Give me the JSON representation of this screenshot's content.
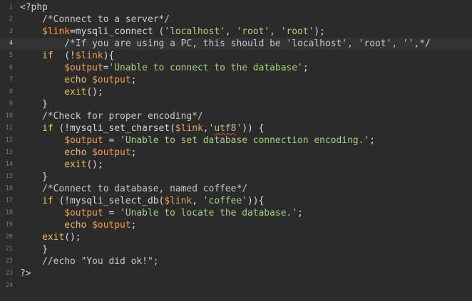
{
  "editor": {
    "active_line": 4,
    "lines": [
      {
        "n": "1",
        "indent": "",
        "tokens": [
          {
            "t": "php",
            "v": "<?php"
          }
        ]
      },
      {
        "n": "2",
        "indent": "    ",
        "tokens": [
          {
            "t": "com",
            "v": "/*Connect to a server*/"
          }
        ]
      },
      {
        "n": "3",
        "indent": "    ",
        "tokens": [
          {
            "t": "var",
            "v": "$link"
          },
          {
            "t": "plain",
            "v": "=mysqli_connect ("
          },
          {
            "t": "str",
            "v": "'localhost'"
          },
          {
            "t": "plain",
            "v": ", "
          },
          {
            "t": "str",
            "v": "'root'"
          },
          {
            "t": "plain",
            "v": ", "
          },
          {
            "t": "str",
            "v": "'root'"
          },
          {
            "t": "plain",
            "v": ");"
          }
        ]
      },
      {
        "n": "4",
        "indent": "        ",
        "tokens": [
          {
            "t": "com",
            "v": "/*If you are using a PC, this should be 'localhost', 'root', '',*/"
          }
        ]
      },
      {
        "n": "5",
        "indent": "    ",
        "tokens": [
          {
            "t": "kw",
            "v": "if"
          },
          {
            "t": "plain",
            "v": "  (!"
          },
          {
            "t": "var",
            "v": "$link"
          },
          {
            "t": "plain",
            "v": "){"
          }
        ]
      },
      {
        "n": "6",
        "indent": "        ",
        "tokens": [
          {
            "t": "var",
            "v": "$output"
          },
          {
            "t": "plain",
            "v": "="
          },
          {
            "t": "str",
            "v": "'Unable to connect to the database'"
          },
          {
            "t": "plain",
            "v": ";"
          }
        ]
      },
      {
        "n": "7",
        "indent": "        ",
        "tokens": [
          {
            "t": "kw",
            "v": "echo"
          },
          {
            "t": "plain",
            "v": " "
          },
          {
            "t": "var",
            "v": "$output"
          },
          {
            "t": "plain",
            "v": ";"
          }
        ]
      },
      {
        "n": "8",
        "indent": "        ",
        "tokens": [
          {
            "t": "kw",
            "v": "exit"
          },
          {
            "t": "plain",
            "v": "();"
          }
        ]
      },
      {
        "n": "9",
        "indent": "    ",
        "tokens": [
          {
            "t": "plain",
            "v": "}"
          }
        ]
      },
      {
        "n": "10",
        "indent": "    ",
        "tokens": [
          {
            "t": "com",
            "v": "/*Check for proper encoding*/"
          }
        ]
      },
      {
        "n": "11",
        "indent": "    ",
        "tokens": [
          {
            "t": "kw",
            "v": "if"
          },
          {
            "t": "plain",
            "v": " (!mysqli_set_charset("
          },
          {
            "t": "var",
            "v": "$link"
          },
          {
            "t": "plain",
            "v": ","
          },
          {
            "t": "str",
            "v": "'"
          },
          {
            "t": "strsq",
            "v": "utf8"
          },
          {
            "t": "str",
            "v": "'"
          },
          {
            "t": "plain",
            "v": ")) {"
          }
        ]
      },
      {
        "n": "12",
        "indent": "        ",
        "tokens": [
          {
            "t": "var",
            "v": "$output"
          },
          {
            "t": "plain",
            "v": " = "
          },
          {
            "t": "str",
            "v": "'Unable to set database connection encoding.'"
          },
          {
            "t": "plain",
            "v": ";"
          }
        ]
      },
      {
        "n": "13",
        "indent": "        ",
        "tokens": [
          {
            "t": "kw",
            "v": "echo"
          },
          {
            "t": "plain",
            "v": " "
          },
          {
            "t": "var",
            "v": "$output"
          },
          {
            "t": "plain",
            "v": ";"
          }
        ]
      },
      {
        "n": "14",
        "indent": "        ",
        "tokens": [
          {
            "t": "kw",
            "v": "exit"
          },
          {
            "t": "plain",
            "v": "();"
          }
        ]
      },
      {
        "n": "15",
        "indent": "    ",
        "tokens": [
          {
            "t": "plain",
            "v": "}"
          }
        ]
      },
      {
        "n": "16",
        "indent": "    ",
        "tokens": [
          {
            "t": "com",
            "v": "/*Connect to database, named coffee*/"
          }
        ]
      },
      {
        "n": "17",
        "indent": "    ",
        "tokens": [
          {
            "t": "kw",
            "v": "if"
          },
          {
            "t": "plain",
            "v": " (!mysqli_select_db("
          },
          {
            "t": "var",
            "v": "$link"
          },
          {
            "t": "plain",
            "v": ", "
          },
          {
            "t": "str",
            "v": "'coffee'"
          },
          {
            "t": "plain",
            "v": ")){"
          }
        ]
      },
      {
        "n": "18",
        "indent": "        ",
        "tokens": [
          {
            "t": "var",
            "v": "$output"
          },
          {
            "t": "plain",
            "v": " = "
          },
          {
            "t": "str",
            "v": "'Unable to locate the database.'"
          },
          {
            "t": "plain",
            "v": ";"
          }
        ]
      },
      {
        "n": "19",
        "indent": "        ",
        "tokens": [
          {
            "t": "kw",
            "v": "echo"
          },
          {
            "t": "plain",
            "v": " "
          },
          {
            "t": "var",
            "v": "$output"
          },
          {
            "t": "plain",
            "v": ";"
          }
        ]
      },
      {
        "n": "20",
        "indent": "    ",
        "tokens": [
          {
            "t": "kw",
            "v": "exit"
          },
          {
            "t": "plain",
            "v": "();"
          }
        ]
      },
      {
        "n": "21",
        "indent": "    ",
        "tokens": [
          {
            "t": "plain",
            "v": "}"
          }
        ]
      },
      {
        "n": "22",
        "indent": "    ",
        "tokens": [
          {
            "t": "com",
            "v": "//echo \"You did ok!\";"
          }
        ]
      },
      {
        "n": "23",
        "indent": "",
        "tokens": [
          {
            "t": "php",
            "v": "?>"
          }
        ]
      },
      {
        "n": "24",
        "indent": "",
        "tokens": []
      }
    ]
  }
}
